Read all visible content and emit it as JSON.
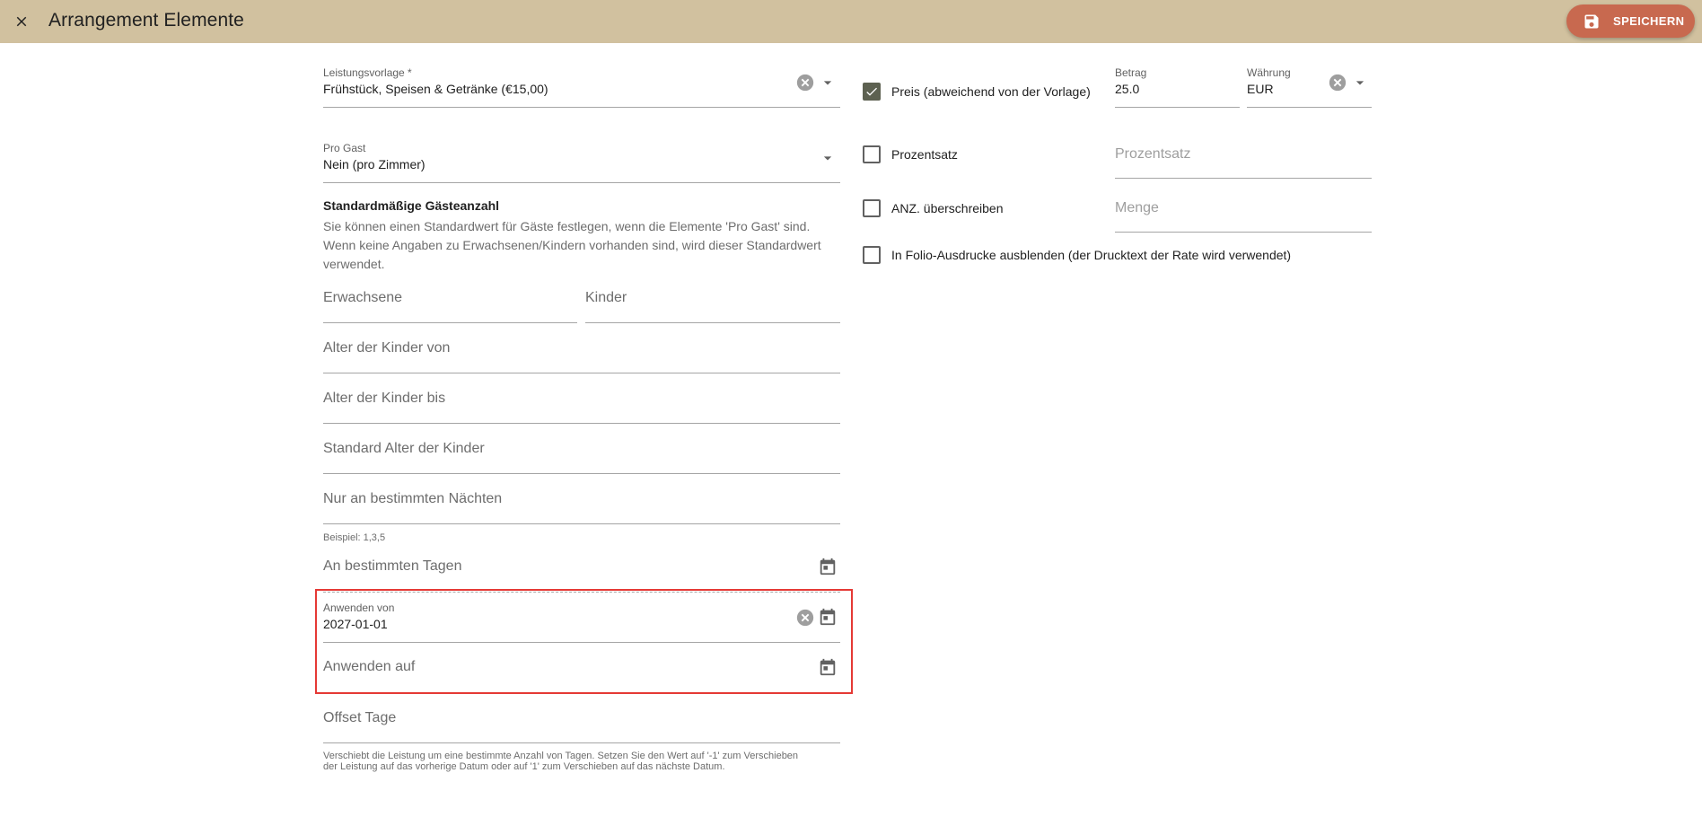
{
  "header": {
    "title": "Arrangement Elemente",
    "save_label": "SPEICHERN"
  },
  "colors": {
    "header_bg": "#d1c19f",
    "save_button": "#c8694f",
    "checkbox_checked": "#5d6151",
    "highlight_border": "#e53935"
  },
  "left": {
    "service_template": {
      "label": "Leistungsvorlage *",
      "value": "Frühstück, Speisen & Getränke (€15,00)"
    },
    "per_guest": {
      "label": "Pro Gast",
      "value": "Nein (pro Zimmer)"
    },
    "default_guests": {
      "title": "Standardmäßige Gästeanzahl",
      "description": "Sie können einen Standardwert für Gäste festlegen, wenn die Elemente 'Pro Gast' sind. Wenn keine Angaben zu Erwachsenen/Kindern vorhanden sind, wird dieser Standardwert verwendet."
    },
    "adults_placeholder": "Erwachsene",
    "children_placeholder": "Kinder",
    "child_age_from_placeholder": "Alter der Kinder von",
    "child_age_to_placeholder": "Alter der Kinder bis",
    "default_child_age_placeholder": "Standard Alter der Kinder",
    "specific_nights": {
      "placeholder": "Nur an bestimmten Nächten",
      "hint": "Beispiel: 1,3,5"
    },
    "specific_days_placeholder": "An bestimmten Tagen",
    "apply_from": {
      "label": "Anwenden von",
      "value": "2027-01-01"
    },
    "apply_to_placeholder": "Anwenden auf",
    "offset_days": {
      "placeholder": "Offset Tage",
      "hint_line1": "Verschiebt die Leistung um eine bestimmte Anzahl von Tagen. Setzen Sie den Wert auf '-1' zum Verschieben",
      "hint_line2": "der Leistung auf das vorherige Datum oder auf '1' zum Verschieben auf das nächste Datum."
    }
  },
  "right": {
    "price_override": {
      "label": "Preis (abweichend von der Vorlage)",
      "checked": true
    },
    "amount": {
      "label": "Betrag",
      "value": "25.0"
    },
    "currency": {
      "label": "Währung",
      "value": "EUR"
    },
    "percentage": {
      "label": "Prozentsatz",
      "placeholder": "Prozentsatz",
      "checked": false
    },
    "qty_override": {
      "label": "ANZ. überschreiben",
      "placeholder": "Menge",
      "checked": false
    },
    "hide_in_folio": {
      "label": "In Folio-Ausdrucke ausblenden (der Drucktext der Rate wird verwendet)",
      "checked": false
    }
  }
}
